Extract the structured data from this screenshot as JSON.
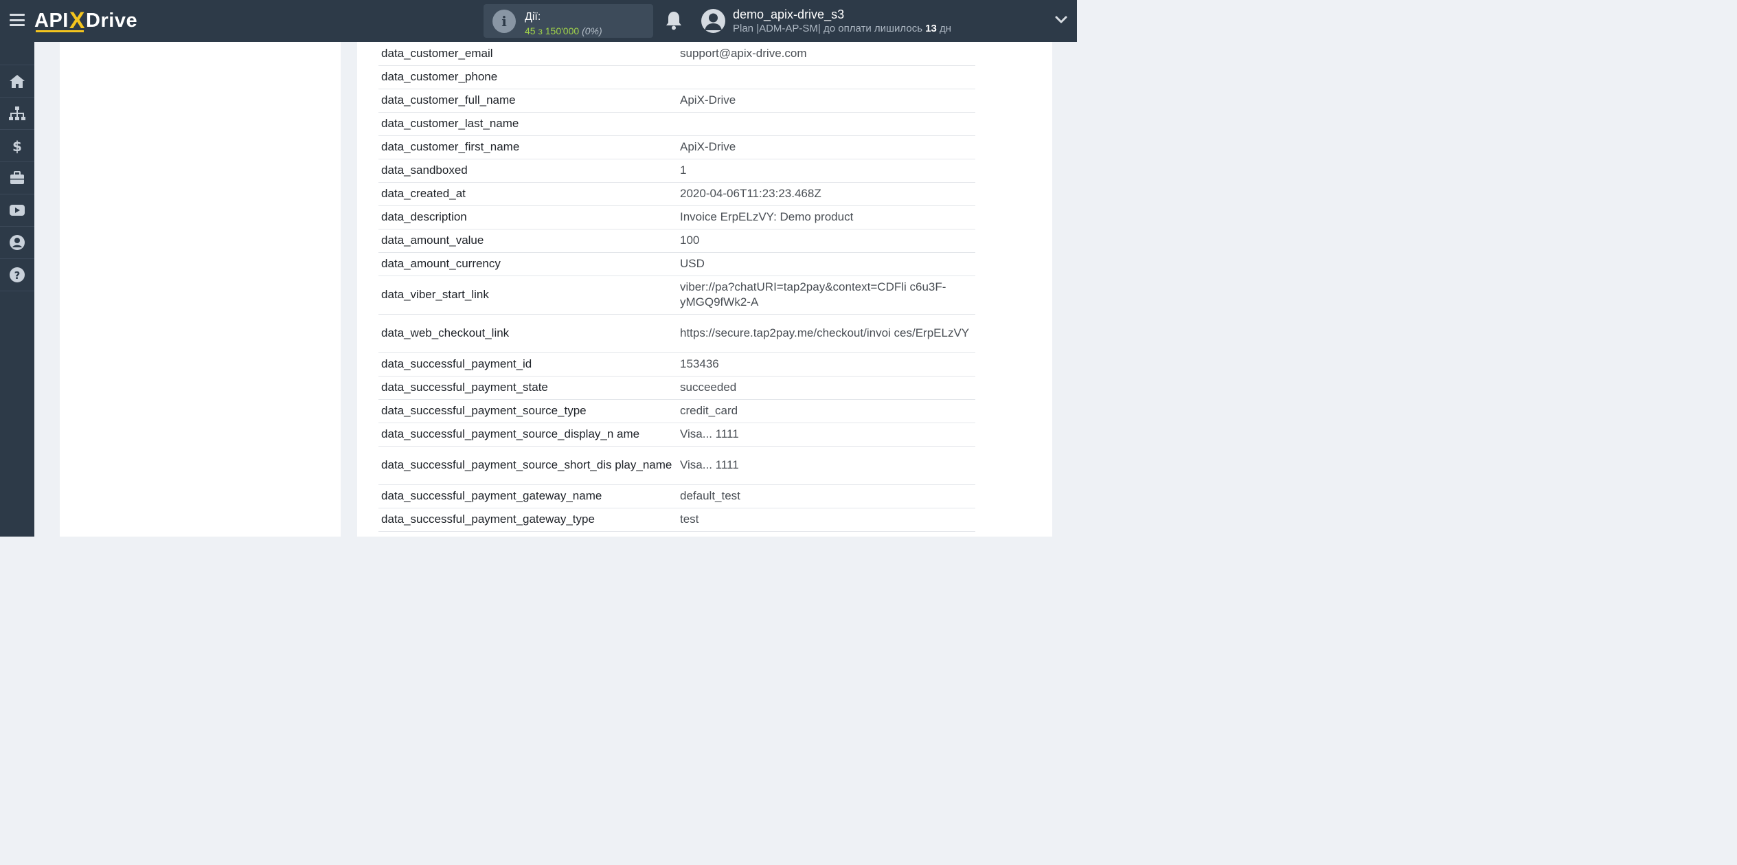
{
  "header": {
    "logo_text_a": "API",
    "logo_text_x": "X",
    "logo_text_b": "Drive",
    "actions_label": "Дії:",
    "actions_count": "45 з 150'000",
    "actions_percent": "(0%)",
    "user_name": "demo_apix-drive_s3",
    "plan_prefix": "Plan |ADM-AP-SM| до оплати лишилось",
    "plan_days": "13",
    "plan_suffix": "дн"
  },
  "sidebar": {
    "items": [
      {
        "icon": "home-icon"
      },
      {
        "icon": "sitemap-icon"
      },
      {
        "icon": "dollar-icon"
      },
      {
        "icon": "briefcase-icon"
      },
      {
        "icon": "youtube-icon"
      },
      {
        "icon": "user-icon"
      },
      {
        "icon": "help-icon"
      }
    ]
  },
  "table": {
    "rows": [
      {
        "key": "data_customer_email",
        "value": "support@apix-drive.com"
      },
      {
        "key": "data_customer_phone",
        "value": ""
      },
      {
        "key": "data_customer_full_name",
        "value": "ApiX-Drive"
      },
      {
        "key": "data_customer_last_name",
        "value": ""
      },
      {
        "key": "data_customer_first_name",
        "value": "ApiX-Drive"
      },
      {
        "key": "data_sandboxed",
        "value": "1"
      },
      {
        "key": "data_created_at",
        "value": "2020-04-06T11:23:23.468Z"
      },
      {
        "key": "data_description",
        "value": "Invoice ErpELzVY: Demo product"
      },
      {
        "key": "data_amount_value",
        "value": "100"
      },
      {
        "key": "data_amount_currency",
        "value": "USD"
      },
      {
        "key": "data_viber_start_link",
        "value": "viber://pa?chatURI=tap2pay&context=CDFli c6u3F-yMGQ9fWk2-A"
      },
      {
        "key": "data_web_checkout_link",
        "value": "https://secure.tap2pay.me/checkout/invoi ces/ErpELzVY"
      },
      {
        "key": "data_successful_payment_id",
        "value": "153436"
      },
      {
        "key": "data_successful_payment_state",
        "value": "succeeded"
      },
      {
        "key": "data_successful_payment_source_type",
        "value": "credit_card"
      },
      {
        "key": "data_successful_payment_source_display_n ame",
        "value": "Visa... 1111"
      },
      {
        "key": "data_successful_payment_source_short_dis play_name",
        "value": "Visa... 1111"
      },
      {
        "key": "data_successful_payment_gateway_name",
        "value": "default_test"
      },
      {
        "key": "data_successful_payment_gateway_type",
        "value": "test"
      }
    ]
  }
}
